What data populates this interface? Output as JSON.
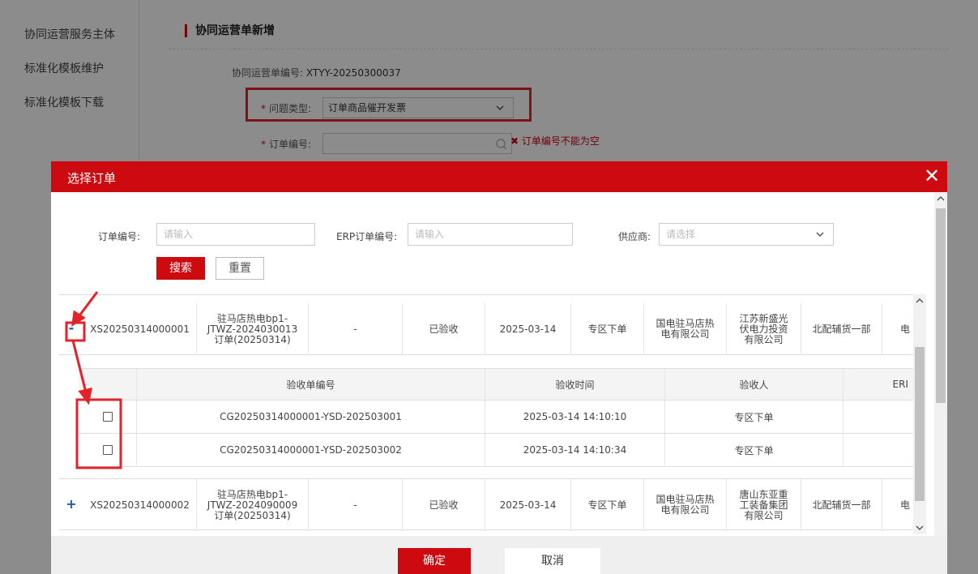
{
  "sidebar": {
    "items": [
      {
        "label": "协同运营服务主体"
      },
      {
        "label": "标准化模板维护"
      },
      {
        "label": "标准化模板下载"
      }
    ]
  },
  "form": {
    "section_title": "协同运营单新增",
    "order_no_label": "协同运营单编号:",
    "order_no_value": "XTYY-20250300037",
    "issue_type_label": "问题类型:",
    "issue_type_value": "订单商品催开发票",
    "order_field_label": "订单编号:",
    "order_field_error": "订单编号不能为空",
    "required_mark": "*"
  },
  "modal": {
    "title": "选择订单",
    "close_glyph": "✕",
    "search": {
      "order_no_label": "订单编号:",
      "order_no_placeholder": "请输入",
      "erp_no_label": "ERP订单编号:",
      "erp_no_placeholder": "请输入",
      "supplier_label": "供应商:",
      "supplier_placeholder": "请选择",
      "search_button": "搜索",
      "reset_button": "重置"
    },
    "orders": [
      {
        "toggle": "-",
        "expanded": true,
        "order_no": "XS20250314000001",
        "name_line1": "驻马店热电bp1-",
        "name_line2": "JTWZ-2024030013",
        "name_line3": "订单(20250314)",
        "erp_no": "-",
        "status": "已验收",
        "date": "2025-03-14",
        "channel": "专区下单",
        "buyer_line1": "国电驻马店热",
        "buyer_line2": "电有限公司",
        "supplier_line1": "江苏新盛光",
        "supplier_line2": "伏电力投资",
        "supplier_line3": "有限公司",
        "dept": "北配辅货一部",
        "extra": "电"
      },
      {
        "toggle": "+",
        "expanded": false,
        "order_no": "XS20250314000002",
        "name_line1": "驻马店热电bp1-",
        "name_line2": "JTWZ-2024090009",
        "name_line3": "订单(20250314)",
        "erp_no": "-",
        "status": "已验收",
        "date": "2025-03-14",
        "channel": "专区下单",
        "buyer_line1": "国电驻马店热",
        "buyer_line2": "电有限公司",
        "supplier_line1": "唐山东亚重",
        "supplier_line2": "工装备集团",
        "supplier_line3": "有限公司",
        "dept": "北配辅货一部",
        "extra": "电"
      }
    ],
    "receipts": {
      "headers": {
        "receipt_no": "验收单编号",
        "receipt_time": "验收时间",
        "receiver": "验收人",
        "erp": "ERI"
      },
      "rows": [
        {
          "receipt_no": "CG20250314000001-YSD-202503001",
          "receipt_time": "2025-03-14 14:10:10",
          "receiver": "专区下单",
          "checked": false
        },
        {
          "receipt_no": "CG20250314000001-YSD-202503002",
          "receipt_time": "2025-03-14 14:10:34",
          "receiver": "专区下单",
          "checked": false
        }
      ]
    },
    "footer": {
      "confirm": "确定",
      "cancel": "取消"
    }
  },
  "colors": {
    "brand_red": "#cc0a0f",
    "annotation_red": "#e2232a",
    "toggle_blue": "#1a5ab8"
  },
  "icons": {
    "search": "search-icon",
    "chevron": "chevron-down-icon",
    "close": "close-icon",
    "error": "error-x-icon"
  }
}
